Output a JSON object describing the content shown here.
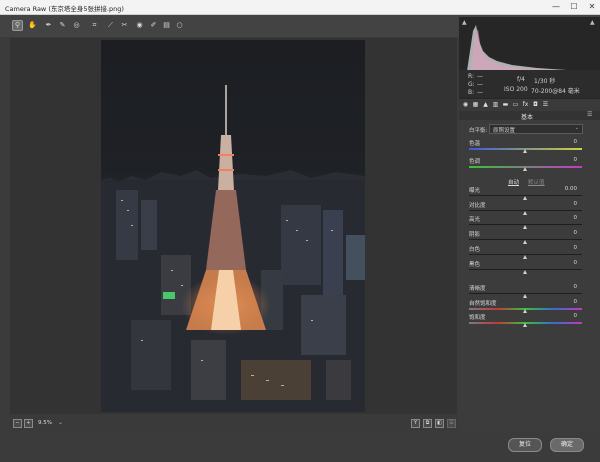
{
  "window": {
    "title": "Camera Raw (东京塔全身5张拼接.png)",
    "minimize": "—",
    "maximize": "☐",
    "close": "✕"
  },
  "toolbar": {
    "tools": [
      "zoom-tool",
      "hand-tool",
      "white-balance-tool",
      "color-sampler-tool",
      "targeted-adjustment-tool",
      "crop-tool",
      "straighten-tool",
      "spot-removal-tool",
      "red-eye-tool",
      "adjustment-brush",
      "graduated-filter",
      "radial-filter"
    ],
    "fullscreen_icon": "⇱"
  },
  "zoom": {
    "value": "9.5%",
    "minus": "−",
    "plus": "+",
    "dropdown": "⌄"
  },
  "view_buttons": [
    "Y",
    "⧉",
    "◧",
    "☰"
  ],
  "metadata": {
    "r_label": "R:",
    "g_label": "G:",
    "b_label": "B:",
    "r_val": "—",
    "g_val": "—",
    "b_val": "—",
    "aperture": "f/4",
    "shutter": "1/30 秒",
    "iso": "ISO 200",
    "lens": "70-200@84 毫米"
  },
  "panel": {
    "title": "基本",
    "fx_label": "fx",
    "white_balance_label": "白平衡:",
    "white_balance_value": "原照设置",
    "auto_label": "自动",
    "default_label": "默认值",
    "sliders_wb": [
      {
        "name": "temperature",
        "label": "色温",
        "value": "0",
        "pos": 0.5
      },
      {
        "name": "tint",
        "label": "色调",
        "value": "0",
        "pos": 0.5
      }
    ],
    "sliders_tone": [
      {
        "name": "exposure",
        "label": "曝光",
        "value": "0.00",
        "pos": 0.5
      },
      {
        "name": "contrast",
        "label": "对比度",
        "value": "0",
        "pos": 0.5
      },
      {
        "name": "highlights",
        "label": "高光",
        "value": "0",
        "pos": 0.5
      },
      {
        "name": "shadows",
        "label": "阴影",
        "value": "0",
        "pos": 0.5
      },
      {
        "name": "whites",
        "label": "白色",
        "value": "0",
        "pos": 0.5
      },
      {
        "name": "blacks",
        "label": "黑色",
        "value": "0",
        "pos": 0.5
      }
    ],
    "sliders_presence": [
      {
        "name": "clarity",
        "label": "清晰度",
        "value": "0",
        "pos": 0.5
      },
      {
        "name": "vibrance",
        "label": "自然饱和度",
        "value": "0",
        "pos": 0.5
      },
      {
        "name": "saturation",
        "label": "饱和度",
        "value": "0",
        "pos": 0.5
      }
    ]
  },
  "footer": {
    "reset_label": "复位",
    "ok_label": "确定"
  },
  "colors": {
    "bg": "#3b3b3b",
    "panel": "#3c3c3c",
    "histogram": "#262626"
  }
}
